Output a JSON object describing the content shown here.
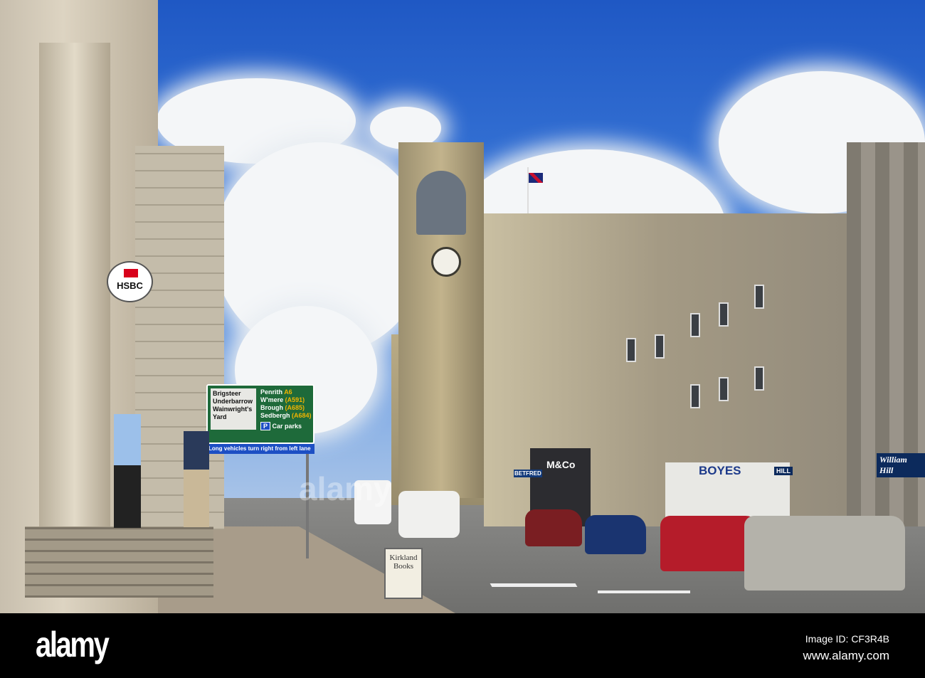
{
  "photo": {
    "bank_sign": "HSBC",
    "road_sign": {
      "left_destinations": [
        "Brigsteer",
        "Underbarrow",
        "Wainwright's",
        "Yard"
      ],
      "right_destinations": [
        {
          "name": "Penrith",
          "road": "A6"
        },
        {
          "name": "W'mere",
          "road": "(A591)"
        },
        {
          "name": "Brough",
          "road": "(A685)"
        },
        {
          "name": "Sedbergh",
          "road": "(A684)"
        }
      ],
      "parking": "P",
      "car_parks": "Car parks",
      "notice": "Long vehicles turn right from left lane"
    },
    "shops": [
      "M&Co",
      "BOYES",
      "William Hill",
      "BETFRED",
      "HILL"
    ],
    "board_text": [
      "Kirkland",
      "Books"
    ],
    "watermark": "alamy"
  },
  "footer": {
    "logo": "alamy",
    "image_id": "Image ID: CF3R4B",
    "url": "www.alamy.com"
  }
}
